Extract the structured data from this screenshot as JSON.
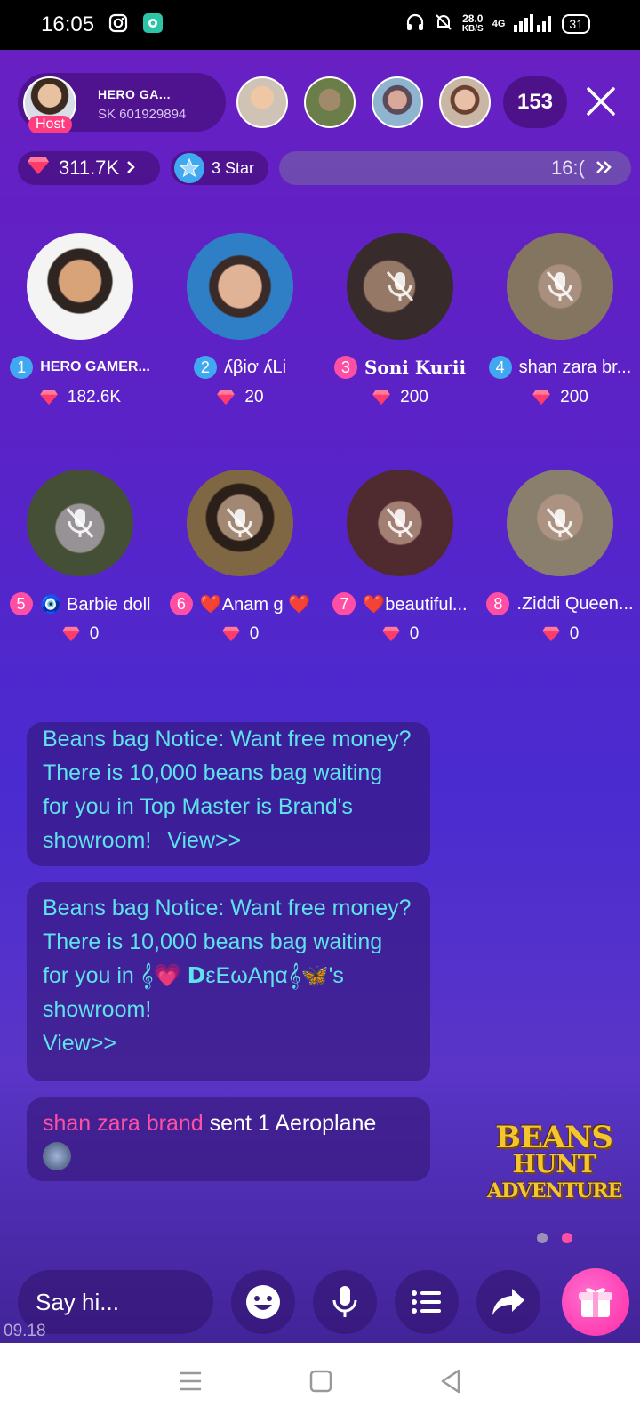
{
  "status_bar": {
    "time": "16:05",
    "net_speed_value": "28.0",
    "net_speed_unit": "KB/S",
    "network": "4G",
    "battery": "31"
  },
  "room": {
    "host": {
      "badge": "Host",
      "name": "HERO GA...",
      "id": "SK 601929894"
    },
    "viewer_count": "153",
    "gems": "311.7K",
    "star_level": "3 Star",
    "progress_text": "16:("
  },
  "seats": [
    {
      "num": "1",
      "name": "HERO GAMER...",
      "gems": "182.6K"
    },
    {
      "num": "2",
      "name": "ʎβiơ ʎLi",
      "gems": "20"
    },
    {
      "num": "3",
      "name": "Soni Kurii",
      "gems": "200"
    },
    {
      "num": "4",
      "name": "shan zara br...",
      "gems": "200"
    },
    {
      "num": "5",
      "name": "🧿 Barbie doll",
      "gems": "0"
    },
    {
      "num": "6",
      "name": "❤️Anam g ❤️",
      "gems": "0"
    },
    {
      "num": "7",
      "name": "❤️beautiful...",
      "gems": "0"
    },
    {
      "num": "8",
      "name": ".Ziddi Queen...",
      "gems": "0"
    }
  ],
  "chat": {
    "msg1_text": "Beans bag Notice: Want free money? There is 10,000 beans bag waiting for you in Top Master is Brand's showroom!",
    "msg1_link": "View>>",
    "msg2_text": "Beans bag Notice: Want free money? There is 10,000 beans bag waiting for you in 𝄞💗 𝗗εEωΑηα𝄞🦋's showroom!",
    "msg2_link": "View>>",
    "gift_user": "shan zara brand",
    "gift_text": "sent 1 Aeroplane"
  },
  "promo": {
    "line1": "BEANS",
    "line2": "HUNT",
    "line3": "ADVENTURE"
  },
  "bottom": {
    "input_placeholder": "Say hi...",
    "version": "09.18"
  },
  "colors": {
    "host_badge": "#ff3d7f",
    "seat_num_blue": "#3fa8f0",
    "seat_num_pink": "#ff4fa4",
    "notice_text": "#5ee3ec",
    "gift_user": "#ff4fa4",
    "gift_button": "#ff2aa6"
  },
  "icons": {
    "status": [
      "instagram-icon",
      "app-icon",
      "headphones-icon",
      "bell-off-icon",
      "signal-icon",
      "battery-icon"
    ],
    "header": [
      "close-icon",
      "gem-icon",
      "chevron-right-icon",
      "star-icon",
      "double-chevron-icon"
    ],
    "seat": [
      "mic-off-icon",
      "gem-icon"
    ],
    "bottom": [
      "emoji-icon",
      "mic-icon",
      "menu-list-icon",
      "share-icon",
      "gift-icon"
    ],
    "nav": [
      "menu-icon",
      "home-icon",
      "back-icon"
    ]
  }
}
